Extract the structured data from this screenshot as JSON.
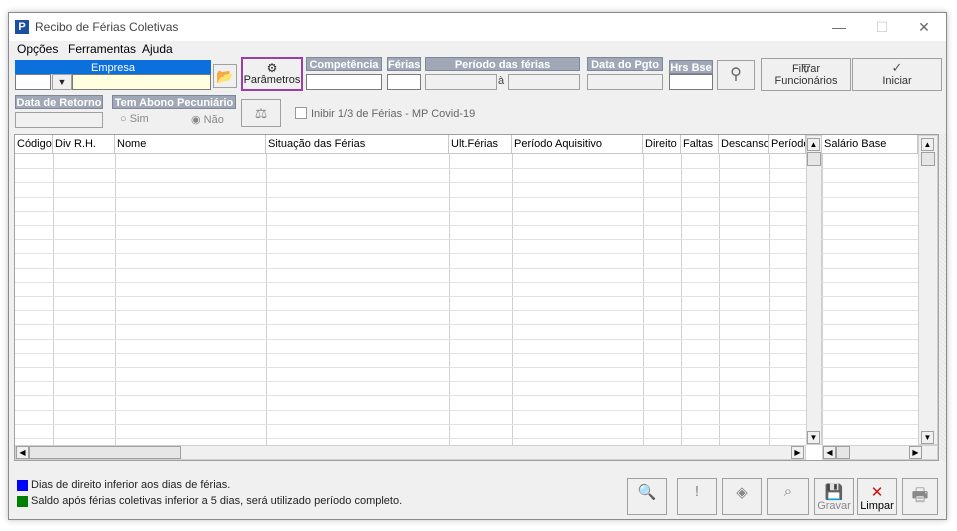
{
  "window": {
    "title": "Recibo de Férias Coletivas",
    "minimize": "—",
    "maximize": "☐",
    "close": "✕"
  },
  "menu": [
    "Opções",
    "Ferramentas",
    "Ajuda"
  ],
  "toolbar": {
    "empresa_label": "Empresa",
    "parametros_label": "Parâmetros",
    "competencia_label": "Competência",
    "ferias_label": "Férias",
    "periodo_label": "Período das férias",
    "periodo_sep": "à",
    "data_pgto_label": "Data do Pgto",
    "hrs_bse_label": "Hrs Bse",
    "filtrar_label": "Filtrar Funcionários",
    "iniciar_label": "Iniciar",
    "data_retorno_label": "Data de Retorno",
    "abono_label": "Tem Abono Pecuniário",
    "abono_sim": "Sim",
    "abono_nao": "Não",
    "inibir_label": "Inibir 1/3 de Férias - MP Covid-19"
  },
  "grid": {
    "columns": [
      "Código",
      "Div R.H.",
      "Nome",
      "Situação das Férias",
      "Ult.Férias",
      "Período Aquisitivo",
      "Direito",
      "Faltas",
      "Descanso",
      "Período"
    ],
    "right_columns": [
      "Salário Base"
    ]
  },
  "legend": {
    "items": [
      {
        "color": "#0000ff",
        "text": "Dias de direito inferior aos dias de férias."
      },
      {
        "color": "#008000",
        "text": "Saldo após férias coletivas inferior a 5 dias, será utilizado período completo."
      }
    ]
  },
  "actions": {
    "gravar_label": "Gravar",
    "limpar_label": "Limpar"
  },
  "colors": {
    "accent": "#0b6fdc",
    "label_bg": "#a0a8b8",
    "highlight": "#9b3fa6"
  }
}
